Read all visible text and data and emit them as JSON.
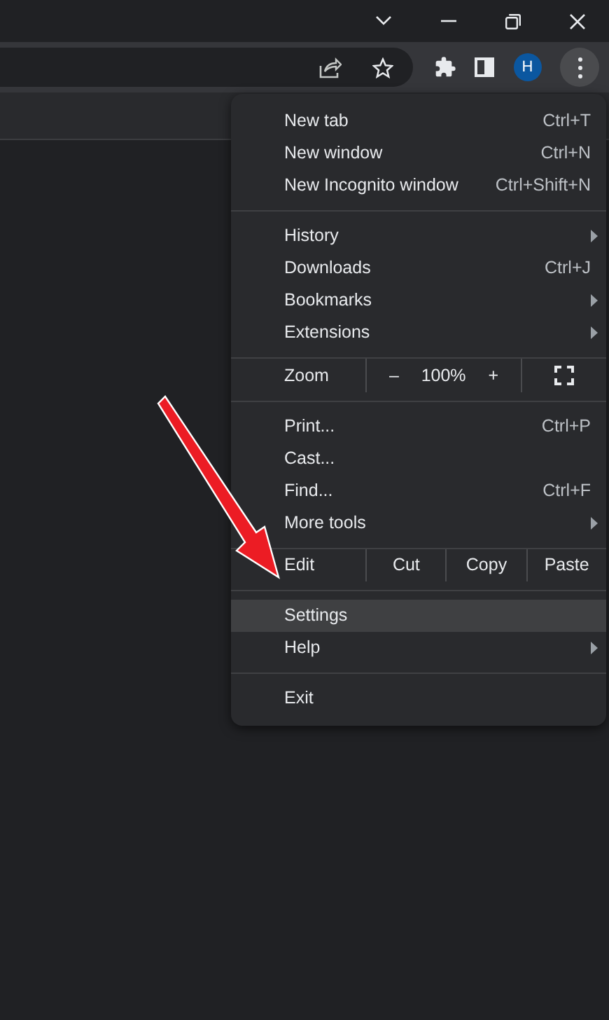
{
  "toolbar": {
    "profile_initial": "H"
  },
  "menu": {
    "sections": [
      [
        {
          "kind": "item",
          "label": "New tab",
          "shortcut": "Ctrl+T",
          "submenu": false,
          "selected": false
        },
        {
          "kind": "item",
          "label": "New window",
          "shortcut": "Ctrl+N",
          "submenu": false,
          "selected": false
        },
        {
          "kind": "item",
          "label": "New Incognito window",
          "shortcut": "Ctrl+Shift+N",
          "submenu": false,
          "selected": false
        }
      ],
      [
        {
          "kind": "item",
          "label": "History",
          "submenu": true,
          "selected": false
        },
        {
          "kind": "item",
          "label": "Downloads",
          "shortcut": "Ctrl+J",
          "submenu": false,
          "selected": false
        },
        {
          "kind": "item",
          "label": "Bookmarks",
          "submenu": true,
          "selected": false
        },
        {
          "kind": "item",
          "label": "Extensions",
          "submenu": true,
          "selected": false
        }
      ],
      [
        {
          "kind": "zoom",
          "label": "Zoom",
          "minus": "–",
          "value": "100%",
          "plus": "+"
        }
      ],
      [
        {
          "kind": "item",
          "label": "Print...",
          "shortcut": "Ctrl+P",
          "submenu": false,
          "selected": false
        },
        {
          "kind": "item",
          "label": "Cast...",
          "submenu": false,
          "selected": false
        },
        {
          "kind": "item",
          "label": "Find...",
          "shortcut": "Ctrl+F",
          "submenu": false,
          "selected": false
        },
        {
          "kind": "item",
          "label": "More tools",
          "submenu": true,
          "selected": false
        }
      ],
      [
        {
          "kind": "edit",
          "label": "Edit",
          "actions": [
            "Cut",
            "Copy",
            "Paste"
          ]
        }
      ],
      [
        {
          "kind": "item",
          "label": "Settings",
          "submenu": false,
          "selected": true
        },
        {
          "kind": "item",
          "label": "Help",
          "submenu": true,
          "selected": false
        }
      ],
      [
        {
          "kind": "item",
          "label": "Exit",
          "submenu": false,
          "selected": false
        }
      ]
    ]
  }
}
